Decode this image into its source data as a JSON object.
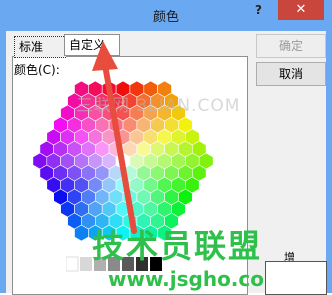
{
  "dialog": {
    "title": "颜色",
    "help_glyph": "?",
    "close_glyph": "✕"
  },
  "tabs": {
    "standard": "标准",
    "custom": "自定义"
  },
  "colors_label": "颜色(C):",
  "buttons": {
    "ok": "确定",
    "cancel": "取消"
  },
  "watermark_site": "三联网 3LIAN.COM",
  "watermark_brand": "技术员联盟",
  "watermark_url": "www.jsgho.com",
  "add_label": "增",
  "accent": {
    "titlebar": "#6aa9f2",
    "close": "#c9463d",
    "arrow": "#e84c3d",
    "watermark": "#2ec04a"
  }
}
